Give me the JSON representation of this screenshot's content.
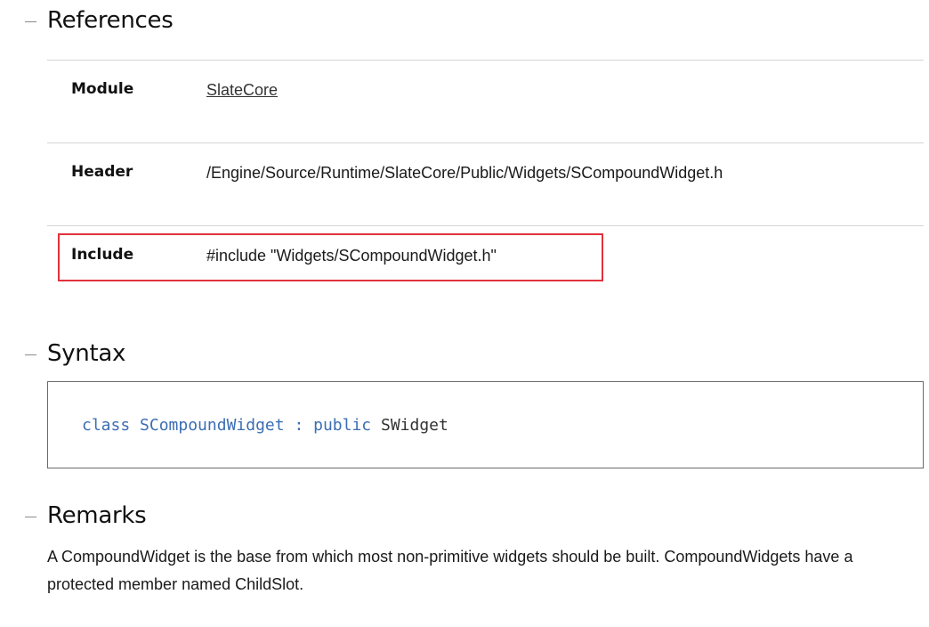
{
  "references": {
    "title": "References",
    "rows": [
      {
        "label": "Module",
        "value": "SlateCore"
      },
      {
        "label": "Header",
        "value": "/Engine/Source/Runtime/SlateCore/Public/Widgets/SCompoundWidget.h"
      },
      {
        "label": "Include",
        "value": "#include \"Widgets/SCompoundWidget.h\""
      }
    ],
    "highlight_color": "#e0323c"
  },
  "syntax": {
    "title": "Syntax",
    "code": {
      "keyword_class": "class",
      "class_name": "SCompoundWidget",
      "separator": ":",
      "keyword_public": "public",
      "base_class": "SWidget"
    },
    "keyword_color": "#3c6eb4"
  },
  "remarks": {
    "title": "Remarks",
    "text": "A CompoundWidget is the base from which most non-primitive widgets should be built. CompoundWidgets have a protected member named ChildSlot."
  }
}
